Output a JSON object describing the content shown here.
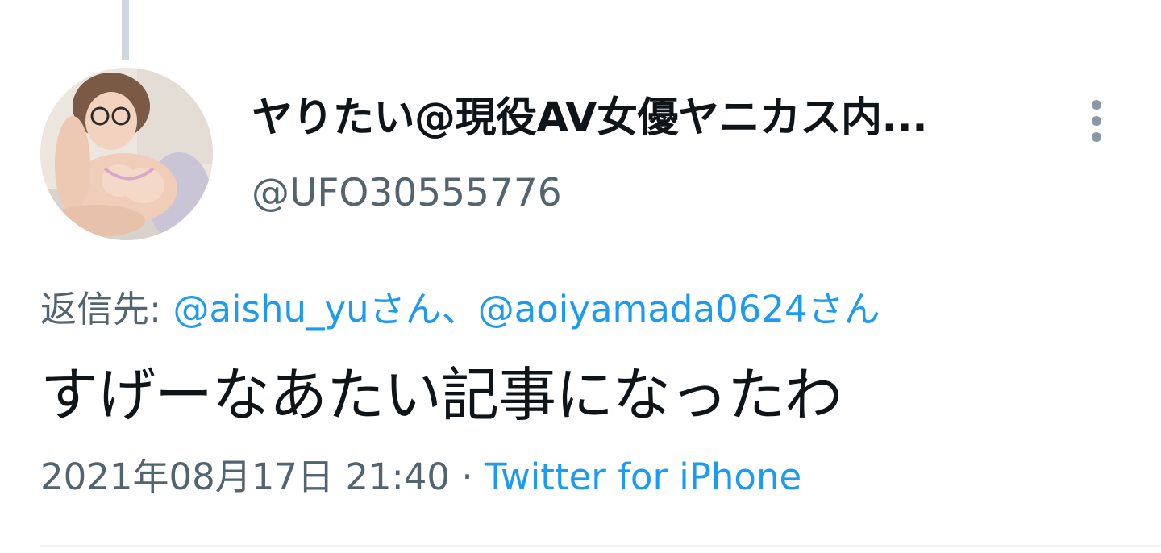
{
  "author": {
    "display_name": "ヤりたい@現役AV女優ヤニカス内...",
    "handle": "@UFO30555776"
  },
  "reply_to": {
    "prefix": "返信先: ",
    "mentions": [
      "@aishu_yuさん",
      "@aoiyamada0624さん"
    ],
    "separator": "、"
  },
  "tweet": {
    "text": "すげーなあたい記事になったわ"
  },
  "meta": {
    "timestamp": "2021年08月17日 21:40",
    "separator": " · ",
    "source": "Twitter for iPhone"
  },
  "colors": {
    "link": "#1d9bf0",
    "secondary_text": "#536471",
    "primary_text": "#0f1419",
    "thread_line": "#cfd9de"
  },
  "icons": {
    "more": "more-vertical-icon"
  }
}
